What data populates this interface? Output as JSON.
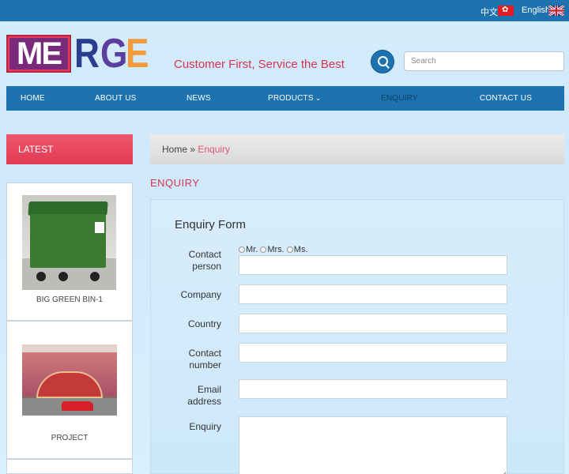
{
  "topbar": {
    "lang_zh": "中文",
    "lang_en": "English"
  },
  "logo": {
    "part1": "ME",
    "part2": "R",
    "part3": "G",
    "part4": "E"
  },
  "header": {
    "slogan": "Customer First, Service the Best",
    "search_placeholder": "Search"
  },
  "nav": {
    "items": [
      {
        "label": "HOME"
      },
      {
        "label": "ABOUT US"
      },
      {
        "label": "NEWS"
      },
      {
        "label": "PRODUCTS"
      },
      {
        "label": "ENQUIRY"
      },
      {
        "label": "CONTACT US"
      }
    ],
    "active": "ENQUIRY"
  },
  "sidebar": {
    "heading": "LATEST",
    "cards": [
      {
        "caption": "BIG GREEN BIN-1"
      },
      {
        "caption": "PROJECT"
      }
    ]
  },
  "breadcrumb": {
    "home": "Home",
    "separator": " » ",
    "current": "Enquiry"
  },
  "main": {
    "title": "ENQUIRY",
    "form": {
      "title": "Enquiry Form",
      "salutations": [
        "Mr.",
        "Mrs.",
        "Ms."
      ],
      "labels": {
        "contact_person_1": "Contact",
        "contact_person_2": "person",
        "company": "Company",
        "country": "Country",
        "contact_number_1": "Contact",
        "contact_number_2": "number",
        "email_1": "Email",
        "email_2": "address",
        "enquiry": "Enquiry"
      }
    }
  },
  "colors": {
    "brand_blue": "#1d72b0",
    "accent_red": "#d8344f"
  }
}
